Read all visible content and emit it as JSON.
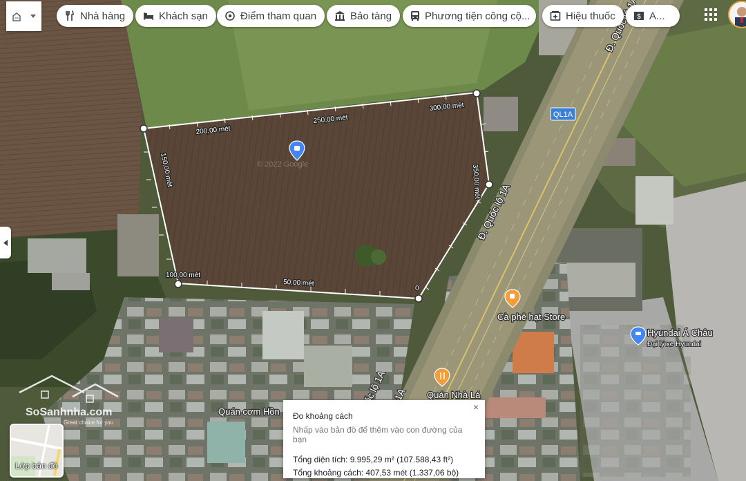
{
  "chips": [
    {
      "label": "Nhà hàng",
      "icon": "fork-knife-icon"
    },
    {
      "label": "Khách sạn",
      "icon": "bed-icon"
    },
    {
      "label": "Điểm tham quan",
      "icon": "camera-icon"
    },
    {
      "label": "Bảo tàng",
      "icon": "museum-icon"
    },
    {
      "label": "Phương tiện công cộ...",
      "icon": "bus-icon"
    },
    {
      "label": "Hiệu thuốc",
      "icon": "pharmacy-icon"
    },
    {
      "label": "A...",
      "icon": "atm-icon"
    }
  ],
  "measure_labels": {
    "m0": "0",
    "m50": "50,00 mét",
    "m100": "100,00 mét",
    "m150": "150,00 mét",
    "m200": "200,00 mét",
    "m250": "250,00 mét",
    "m300": "300,00 mét",
    "m350": "350,00 mét"
  },
  "road": {
    "shield": "QL1A",
    "name_upper": "Đ. Quốc lộ 1A",
    "name_mid": "Đ. Quốc lộ 1A",
    "name_lower_a": "uốc lộ 1A",
    "name_lower_b": "lộ 1A"
  },
  "places": {
    "cafe": "Cà phê hạt Store",
    "hyundai_name": "Hyundai Á Châu",
    "hyundai_sub": "Đại lý xe Hyundai",
    "quan_nha_la": "Quán Nhà Lá",
    "quan_com": "Quán cơm Hồn"
  },
  "watermark": {
    "year": "© 2022 Google",
    "brand": "SoSanhnha.com",
    "tagline": "Great choice for you"
  },
  "layer": {
    "label": "Lớp bản đồ"
  },
  "popup": {
    "title": "Đo khoảng cách",
    "hint": "Nhấp vào bản đồ để thêm vào con đường của bạn",
    "area": "Tổng diện tích: 9.995,29 m² (107.588,43 ft²)",
    "distance": "Tổng khoảng cách: 407,53 mét (1.337,06 bộ)",
    "close": "×"
  },
  "colors": {
    "accent": "#1a73e8",
    "road": "#c5b76a",
    "shield": "#3b80d4",
    "orange": "#f29d37"
  }
}
